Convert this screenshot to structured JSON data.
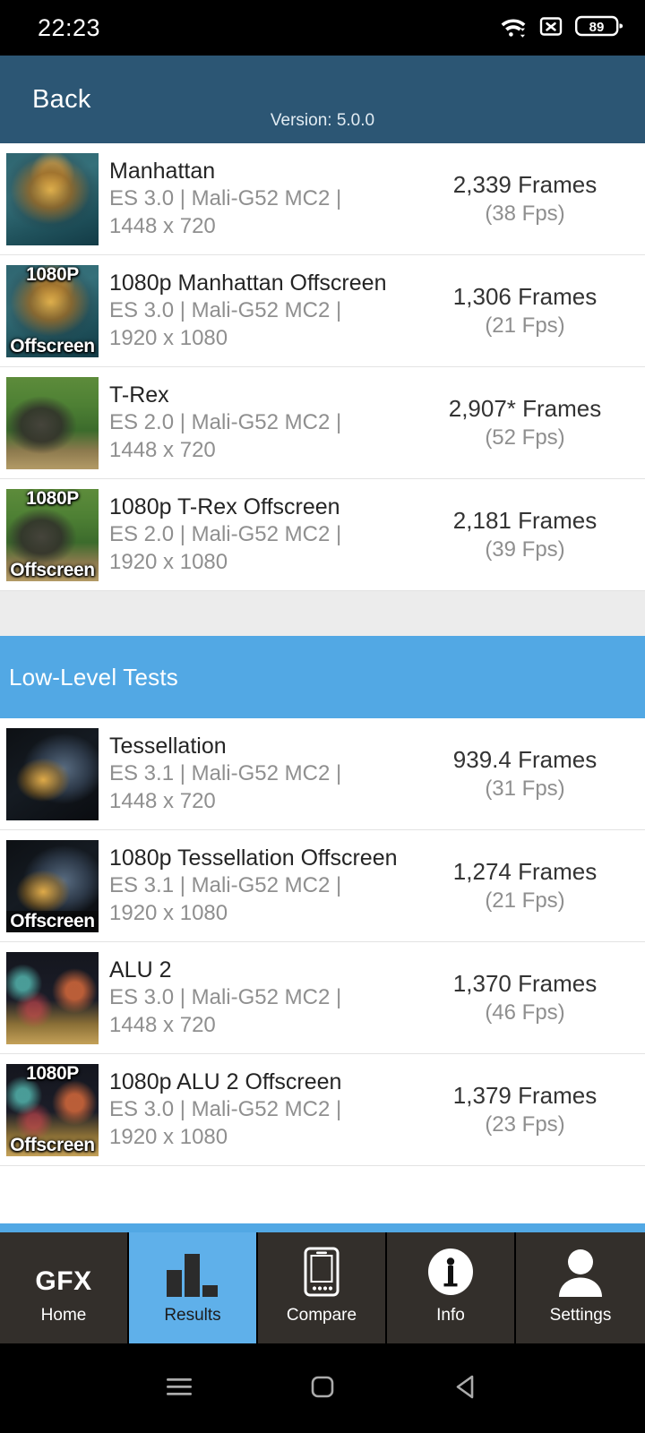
{
  "status_bar": {
    "time": "22:23",
    "battery_level": "89",
    "icons": [
      "wifi-icon",
      "no-sim-icon",
      "battery-icon"
    ]
  },
  "header": {
    "back_label": "Back",
    "version_label": "Version: 5.0.0",
    "background_color": "#2c5674"
  },
  "sections": [
    {
      "title": null,
      "rows": [
        {
          "name": "Manhattan",
          "subtitle_line1": "ES 3.0 | Mali-G52 MC2 |",
          "subtitle_line2": "1448 x 720",
          "frames": "2,339 Frames",
          "fps": "(38 Fps)",
          "thumb": "manhattan",
          "badge_top": null,
          "badge_bottom": null
        },
        {
          "name": "1080p Manhattan Offscreen",
          "subtitle_line1": "ES 3.0 | Mali-G52 MC2 |",
          "subtitle_line2": "1920 x 1080",
          "frames": "1,306 Frames",
          "fps": "(21 Fps)",
          "thumb": "manhattan",
          "badge_top": "1080P",
          "badge_bottom": "Offscreen"
        },
        {
          "name": "T-Rex",
          "subtitle_line1": "ES 2.0 | Mali-G52 MC2 |",
          "subtitle_line2": "1448 x 720",
          "frames": "2,907* Frames",
          "fps": "(52 Fps)",
          "thumb": "trex",
          "badge_top": null,
          "badge_bottom": null
        },
        {
          "name": "1080p T-Rex Offscreen",
          "subtitle_line1": "ES 2.0 | Mali-G52 MC2 |",
          "subtitle_line2": "1920 x 1080",
          "frames": "2,181 Frames",
          "fps": "(39 Fps)",
          "thumb": "trex",
          "badge_top": "1080P",
          "badge_bottom": "Offscreen"
        }
      ]
    },
    {
      "title": "Low-Level Tests",
      "rows": [
        {
          "name": "Tessellation",
          "subtitle_line1": "ES 3.1 | Mali-G52 MC2 |",
          "subtitle_line2": "1448 x 720",
          "frames": "939.4 Frames",
          "fps": "(31 Fps)",
          "thumb": "tessellation",
          "badge_top": null,
          "badge_bottom": null
        },
        {
          "name": "1080p Tessellation Offscreen",
          "subtitle_line1": "ES 3.1 | Mali-G52 MC2 |",
          "subtitle_line2": "1920 x 1080",
          "frames": "1,274 Frames",
          "fps": "(21 Fps)",
          "thumb": "tessellation",
          "badge_top": null,
          "badge_bottom": "Offscreen"
        },
        {
          "name": "ALU 2",
          "subtitle_line1": "ES 3.0 | Mali-G52 MC2 |",
          "subtitle_line2": "1448 x 720",
          "frames": "1,370 Frames",
          "fps": "(46 Fps)",
          "thumb": "alu2",
          "badge_top": null,
          "badge_bottom": null
        },
        {
          "name": "1080p ALU 2 Offscreen",
          "subtitle_line1": "ES 3.0 | Mali-G52 MC2 |",
          "subtitle_line2": "1920 x 1080",
          "frames": "1,379 Frames",
          "fps": "(23 Fps)",
          "thumb": "alu2",
          "badge_top": "1080P",
          "badge_bottom": "Offscreen"
        }
      ]
    }
  ],
  "tabbar": {
    "active_color": "#5fb0ea",
    "inactive_color": "#332f2b",
    "items": [
      {
        "label": "Home",
        "icon": "gfx-logo-icon",
        "active": false,
        "logo_text": "GFX"
      },
      {
        "label": "Results",
        "icon": "bar-chart-icon",
        "active": true
      },
      {
        "label": "Compare",
        "icon": "phone-icon",
        "active": false
      },
      {
        "label": "Info",
        "icon": "info-circle-icon",
        "active": false
      },
      {
        "label": "Settings",
        "icon": "person-icon",
        "active": false
      }
    ]
  },
  "android_nav": {
    "items": [
      "recents-icon",
      "home-icon",
      "back-icon"
    ]
  },
  "colors": {
    "header_blue": "#2c5674",
    "section_blue": "#52a8e4",
    "gap_gray": "#ececec",
    "text_dark": "#242424",
    "text_gray": "#8f8f8f"
  }
}
